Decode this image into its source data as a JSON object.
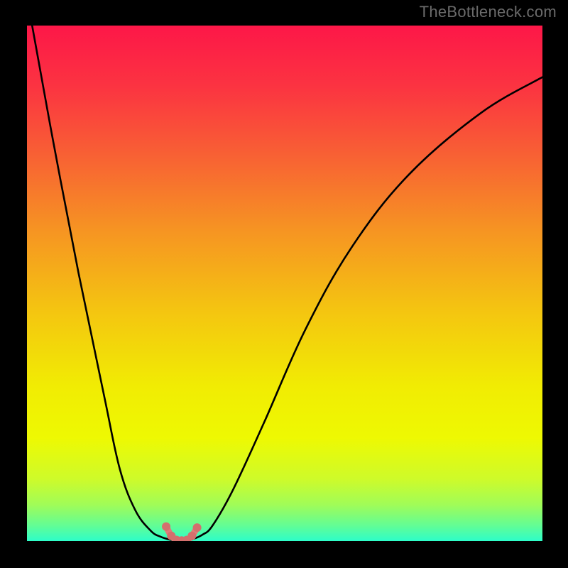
{
  "watermark": "TheBottleneck.com",
  "chart_data": {
    "type": "line",
    "title": "",
    "xlabel": "",
    "ylabel": "",
    "xlim": [
      0,
      100
    ],
    "ylim": [
      0,
      100
    ],
    "grid": false,
    "legend": false,
    "series": [
      {
        "name": "curve-left",
        "color": "#000000",
        "x": [
          1,
          5,
          10,
          15,
          18,
          21,
          24,
          26,
          28
        ],
        "values": [
          100,
          78,
          52,
          28,
          14,
          6,
          2,
          0.8,
          0.2
        ]
      },
      {
        "name": "curve-right",
        "color": "#000000",
        "x": [
          32,
          34,
          36,
          40,
          46,
          54,
          63,
          74,
          88,
          100
        ],
        "values": [
          0.3,
          1.2,
          3,
          10,
          23,
          41,
          57,
          71,
          83,
          90
        ]
      },
      {
        "name": "valley-floor",
        "color": "#e07c7a",
        "x": [
          27,
          28,
          29,
          30,
          31,
          32,
          33
        ],
        "values": [
          2.8,
          1.0,
          0.2,
          0.1,
          0.2,
          1.0,
          2.6
        ]
      }
    ],
    "markers": {
      "series": "valley-floor",
      "color": "#d46f6d",
      "radius": 6,
      "x": [
        27,
        28,
        29,
        30,
        31,
        32,
        33
      ],
      "y": [
        2.8,
        1.0,
        0.2,
        0.1,
        0.2,
        1.0,
        2.6
      ]
    },
    "background_gradient": {
      "type": "vertical",
      "stops": [
        {
          "pct": 0,
          "color": "#fd1748"
        },
        {
          "pct": 12,
          "color": "#fb3441"
        },
        {
          "pct": 25,
          "color": "#f86034"
        },
        {
          "pct": 40,
          "color": "#f69522"
        },
        {
          "pct": 55,
          "color": "#f4c411"
        },
        {
          "pct": 70,
          "color": "#f1ec03"
        },
        {
          "pct": 80,
          "color": "#eef902"
        },
        {
          "pct": 88,
          "color": "#cefb2a"
        },
        {
          "pct": 93,
          "color": "#a0fc58"
        },
        {
          "pct": 97,
          "color": "#62fd95"
        },
        {
          "pct": 100,
          "color": "#2dfdc9"
        }
      ]
    }
  }
}
